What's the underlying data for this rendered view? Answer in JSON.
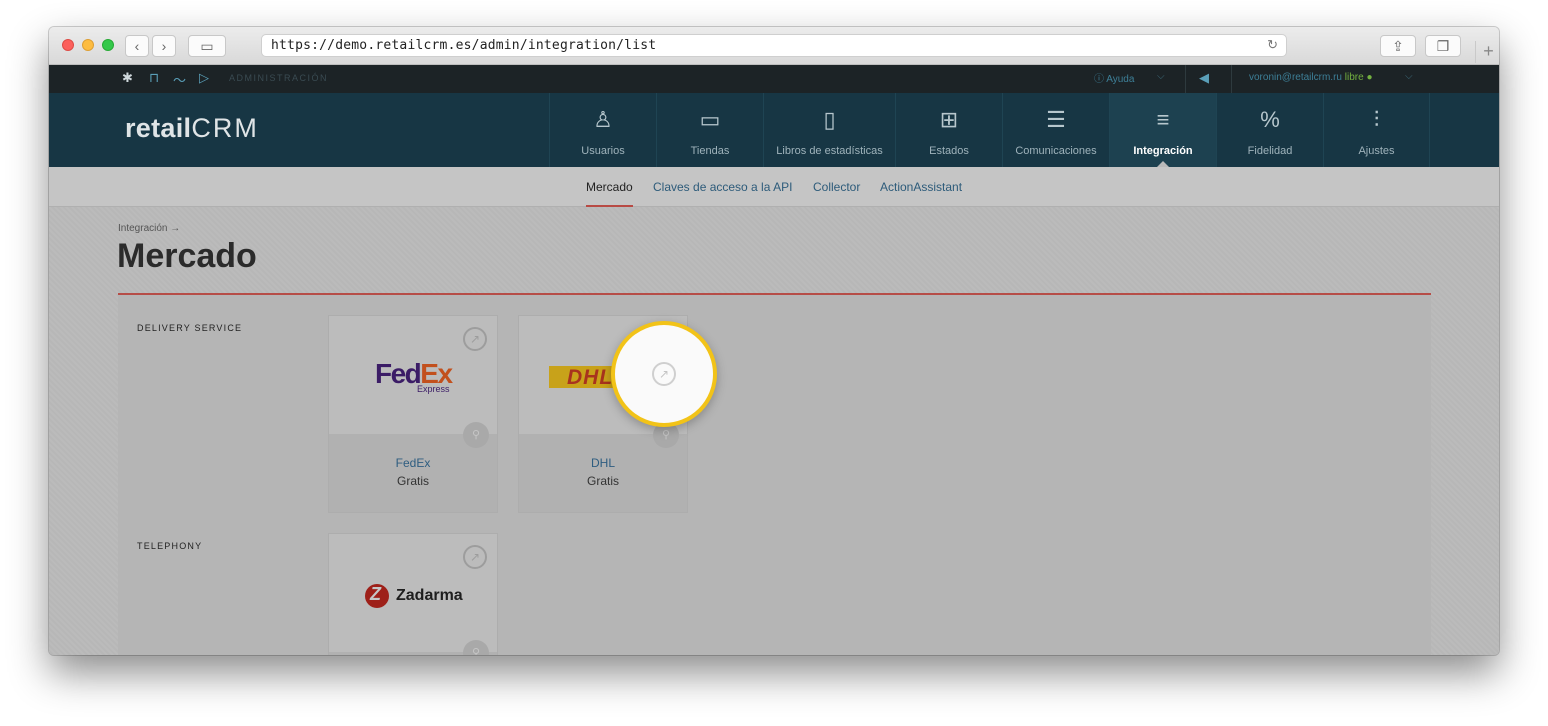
{
  "browser": {
    "url": "https://demo.retailcrm.es/admin/integration/list",
    "new_tab_label": "+"
  },
  "topbar": {
    "section_label": "ADMINISTRACIÓN",
    "help_label": "Ayuda",
    "user_email": "voronin@retailcrm.ru",
    "plan_label": "libre"
  },
  "logo": {
    "retail": "retail",
    "crm": "CRM"
  },
  "nav": [
    {
      "label": "Usuarios",
      "icon": "user-icon"
    },
    {
      "label": "Tiendas",
      "icon": "store-icon"
    },
    {
      "label": "Libros de estadísticas",
      "icon": "book-icon"
    },
    {
      "label": "Estados",
      "icon": "states-icon"
    },
    {
      "label": "Comunicaciones",
      "icon": "communications-icon"
    },
    {
      "label": "Integración",
      "icon": "integration-icon"
    },
    {
      "label": "Fidelidad",
      "icon": "loyalty-icon"
    },
    {
      "label": "Ajustes",
      "icon": "settings-sliders-icon"
    }
  ],
  "subnav": [
    "Mercado",
    "Claves de acceso a la API",
    "Collector",
    "ActionAssistant"
  ],
  "breadcrumb": "Integración →",
  "page_title": "Mercado",
  "sections": [
    {
      "label": "DELIVERY SERVICE"
    },
    {
      "label": "TELEPHONY"
    }
  ],
  "cards": [
    {
      "name": "FedEx",
      "price": "Gratis",
      "logo_main_a": "Fed",
      "logo_main_b": "Ex",
      "logo_sub": "Express"
    },
    {
      "name": "DHL",
      "price": "Gratis",
      "logo_text": "DHL"
    },
    {
      "name": "Zadarma",
      "logo_text": "Zadarma"
    }
  ],
  "colors": {
    "accent_red": "#b64d47",
    "nav_bg": "#173644",
    "highlight_ring": "#f2c318"
  }
}
